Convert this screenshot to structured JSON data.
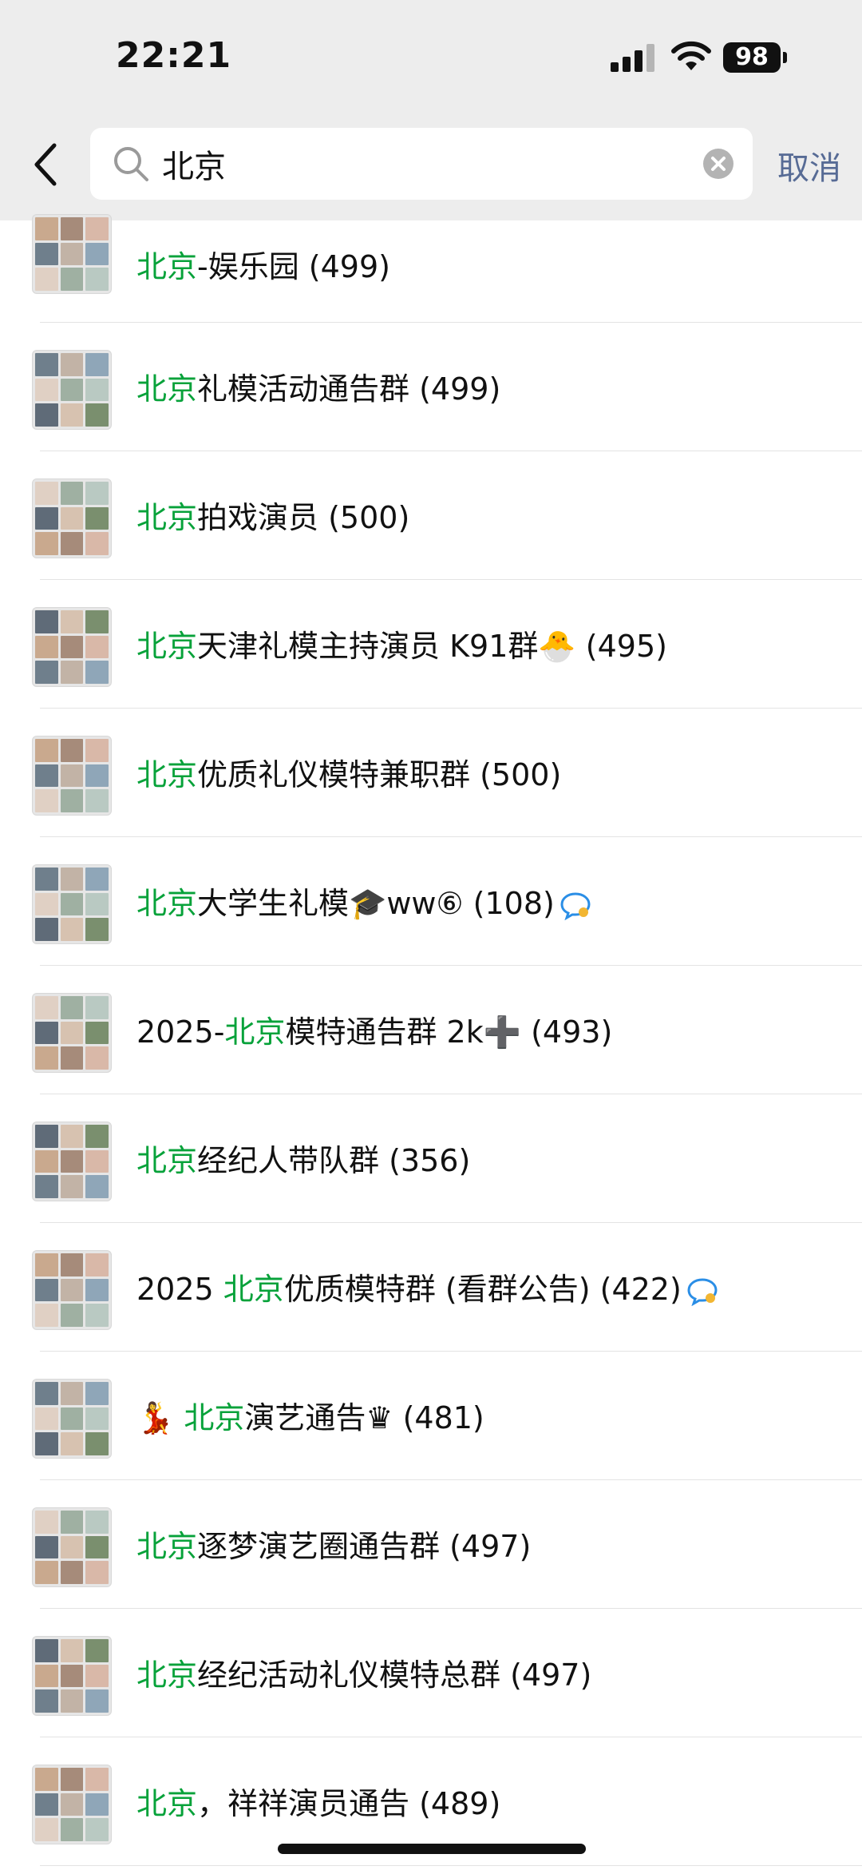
{
  "status_bar": {
    "time": "22:21",
    "battery": "98"
  },
  "search": {
    "query": "北京",
    "cancel_label": "取消"
  },
  "colors": {
    "highlight": "#07a23a",
    "link": "#576b95",
    "topbar": "#ededed"
  },
  "results": [
    {
      "prefix": "",
      "highlight": "北京",
      "suffix": "-娱乐园 (499)"
    },
    {
      "prefix": "",
      "highlight": "北京",
      "suffix": "礼模活动通告群 (499)"
    },
    {
      "prefix": "",
      "highlight": "北京",
      "suffix": "拍戏演员 (500)"
    },
    {
      "prefix": "",
      "highlight": "北京",
      "suffix": "天津礼模主持演员 K91群🐣 (495)"
    },
    {
      "prefix": "",
      "highlight": "北京",
      "suffix": "优质礼仪模特兼职群 (500)"
    },
    {
      "prefix": "",
      "highlight": "北京",
      "suffix": "大学生礼模🎓ww⑥ (108)",
      "badge": "chat-bubble-icon"
    },
    {
      "prefix": "2025-",
      "highlight": "北京",
      "suffix": "模特通告群 2k➕ (493)"
    },
    {
      "prefix": "",
      "highlight": "北京",
      "suffix": "经纪人带队群 (356)"
    },
    {
      "prefix": "2025 ",
      "highlight": "北京",
      "suffix": "优质模特群 (看群公告) (422)",
      "badge": "chat-bubble-icon"
    },
    {
      "prefix": "💃 ",
      "highlight": "北京",
      "suffix": "演艺通告♛ (481)"
    },
    {
      "prefix": "",
      "highlight": "北京",
      "suffix": "逐梦演艺圈通告群 (497)"
    },
    {
      "prefix": "",
      "highlight": "北京",
      "suffix": "经纪活动礼仪模特总群 (497)"
    },
    {
      "prefix": "",
      "highlight": "北京",
      "suffix": "，祥祥演员通告 (489)"
    }
  ]
}
